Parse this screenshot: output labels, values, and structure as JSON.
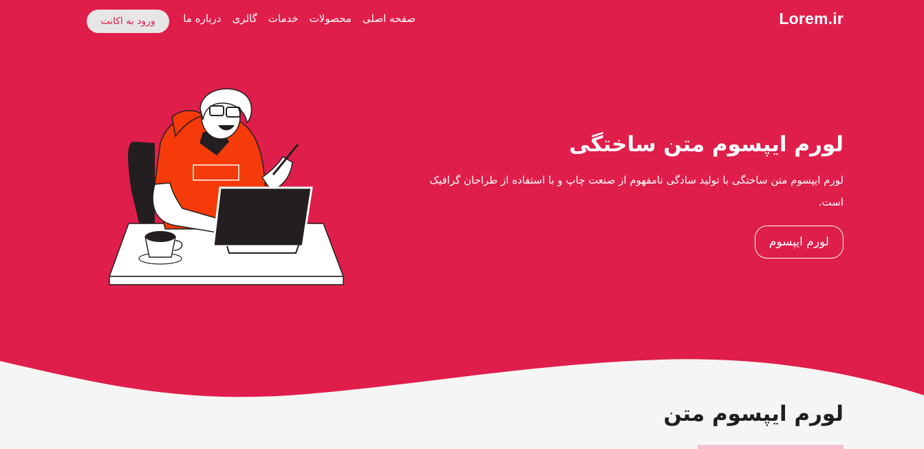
{
  "colors": {
    "accent": "#e01e4b",
    "page_bg": "#f5f5f5",
    "cta_light": "#e6e6e6"
  },
  "navbar": {
    "brand": "Lorem.ir",
    "links": [
      "صفحه اصلی",
      "محصولات",
      "خدمات",
      "گالری",
      "درباره ما"
    ],
    "login_label": "ورود به اکانت"
  },
  "hero": {
    "title": "لورم ایپسوم متن ساختگی",
    "description": "لورم ایپسوم متن ساختگی با تولید سادگی نامفهوم از صنعت چاپ و با استفاده از طراحان گرافیک است.",
    "cta_label": "لورم ایپسوم",
    "illustration_icon": "designer-at-desk-illustration"
  },
  "section": {
    "title": "لورم ایپسوم متن"
  }
}
